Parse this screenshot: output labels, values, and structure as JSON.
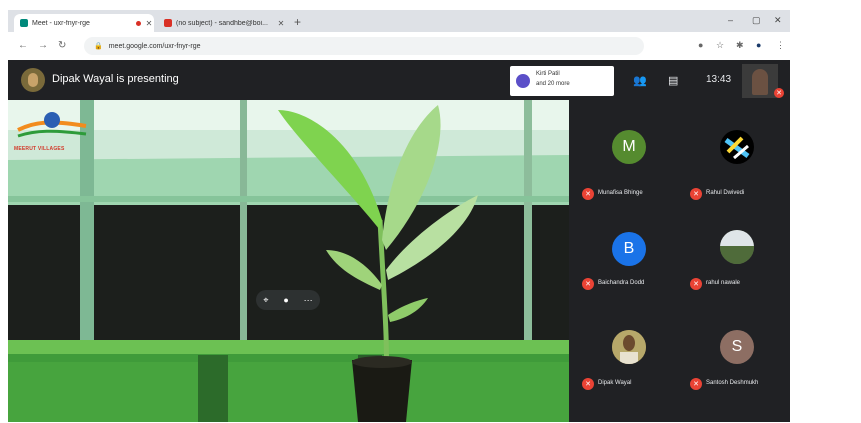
{
  "browser": {
    "tabs": [
      {
        "label": "Meet - uxr-fnyr-rge",
        "active": true
      },
      {
        "label": "(no subject) - sandhbe@boi...",
        "active": false
      }
    ],
    "url": "meet.google.com/uxr-fnyr-rge"
  },
  "meet": {
    "presenter_title": "Dipak Wayal is presenting",
    "chip_line1": "Kirti Patil",
    "chip_line2": "and 20 more",
    "clock": "13:43",
    "watermark_label": "MEERUT VILLAGES",
    "participants": [
      {
        "name": "Munafisa Bhinge",
        "initial": "M",
        "color": "#558b2f"
      },
      {
        "name": "Rahul Dwivedi",
        "initial": "",
        "color": "#000000"
      },
      {
        "name": "Baichandra Dodd",
        "initial": "B",
        "color": "#1a73e8"
      },
      {
        "name": "rahul nawale",
        "initial": "",
        "color": "#6b7d5a"
      },
      {
        "name": "Dipak Wayal",
        "initial": "",
        "color": "#8a7a40"
      },
      {
        "name": "Santosh Deshmukh",
        "initial": "S",
        "color": "#8d6e63"
      }
    ]
  },
  "colors": {
    "meet_bg": "#202124",
    "muted_mic": "#ea4335"
  }
}
